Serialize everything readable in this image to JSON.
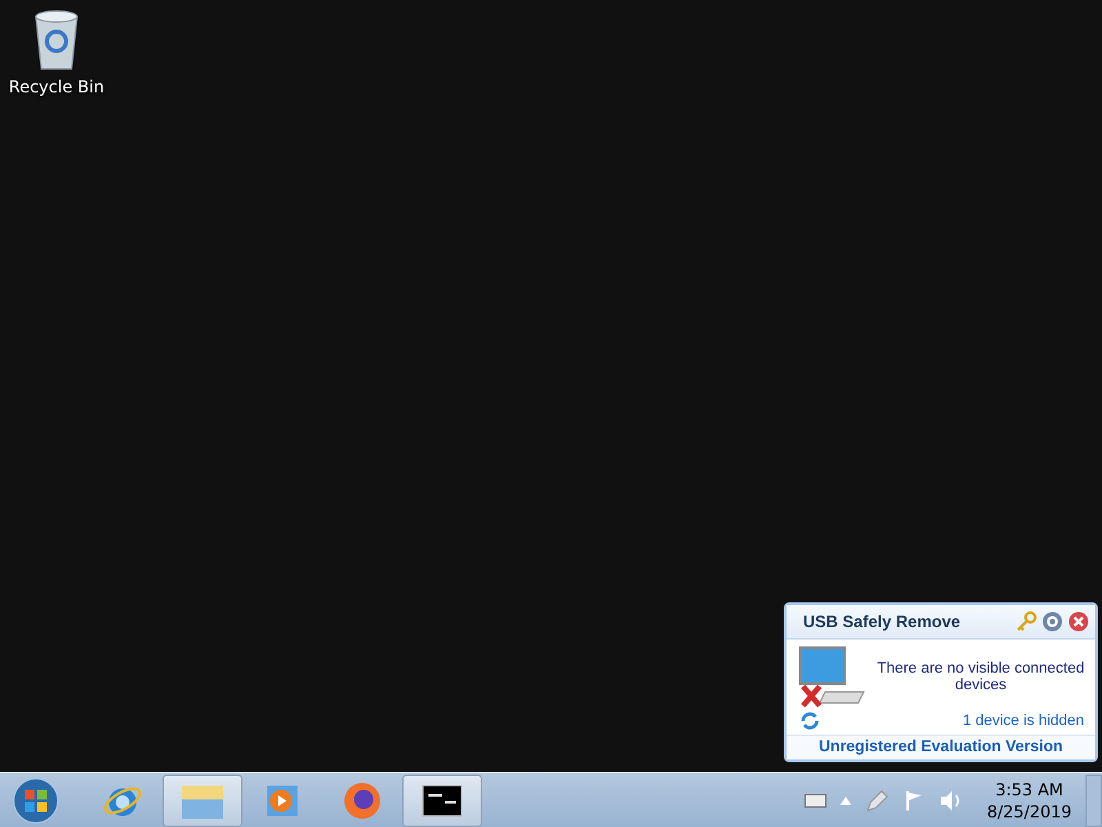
{
  "desktop_icons": [
    {
      "label": "Recycle Bin"
    }
  ],
  "taskbar": {
    "items": [
      {
        "kind": "start"
      },
      {
        "kind": "ie",
        "open": false
      },
      {
        "kind": "explorer",
        "open": true
      },
      {
        "kind": "media",
        "open": false
      },
      {
        "kind": "firefox",
        "open": false
      },
      {
        "kind": "cmd",
        "open": true
      }
    ],
    "clock": {
      "time": "3:53 AM",
      "date": "8/25/2019"
    }
  },
  "popup": {
    "title": "USB Safely Remove",
    "message": "There are no visible connected devices",
    "hidden_link": "1 device is hidden",
    "footer": "Unregistered Evaluation Version"
  }
}
